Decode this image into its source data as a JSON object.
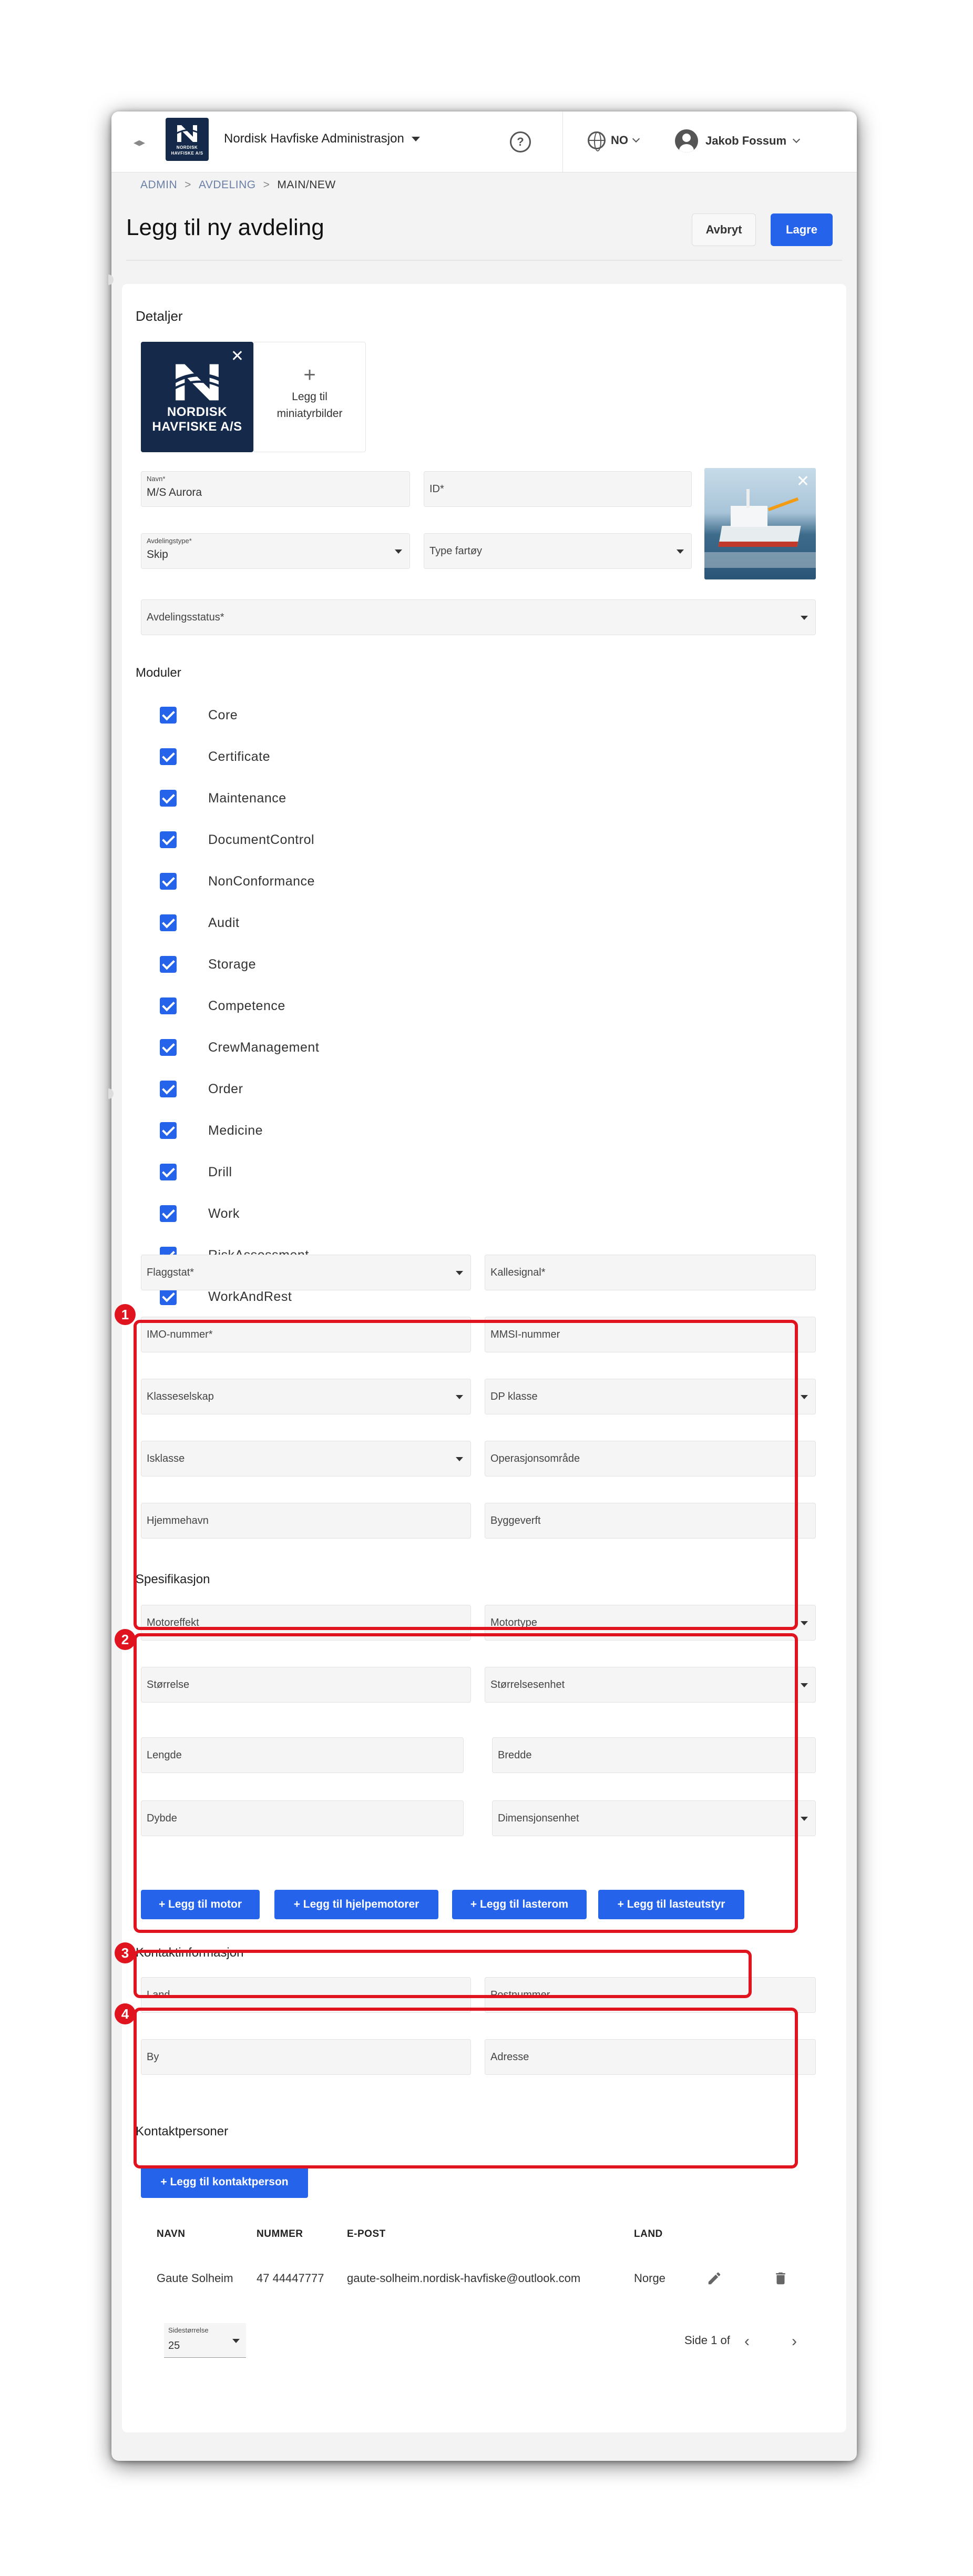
{
  "header": {
    "org_name": "Nordisk Havfiske Administrasjon",
    "logo_text_1": "NORDISK",
    "logo_text_2": "HAVFISKE A/S",
    "language": "NO",
    "user_name": "Jakob Fossum"
  },
  "breadcrumb": [
    "ADMIN",
    "AVDELING",
    "MAIN/NEW"
  ],
  "page": {
    "title": "Legg til ny avdeling",
    "cancel_label": "Avbryt",
    "save_label": "Lagre"
  },
  "details": {
    "section_label": "Detaljer",
    "logo_thumb_line1": "NORDISK",
    "logo_thumb_line2": "HAVFISKE A/S",
    "add_thumb_label_1": "Legg til",
    "add_thumb_label_2": "miniatyrbilder",
    "name_label": "Navn*",
    "name_value": "M/S Aurora",
    "id_placeholder": "ID*",
    "type_label": "Avdelingstype*",
    "type_value": "Skip",
    "vessel_type_placeholder": "Type fartøy",
    "status_placeholder": "Avdelingsstatus*"
  },
  "modules": {
    "label": "Moduler",
    "items": [
      "Core",
      "Certificate",
      "Maintenance",
      "DocumentControl",
      "NonConformance",
      "Audit",
      "Storage",
      "Competence",
      "CrewManagement",
      "Order",
      "Medicine",
      "Drill",
      "Work",
      "RiskAssessment",
      "WorkAndRest"
    ]
  },
  "vessel_info": {
    "badge": "1",
    "flag_state": "Flaggstat*",
    "call_sign": "Kallesignal*",
    "imo": "IMO-nummer*",
    "mmsi": "MMSI-nummer",
    "class_society": "Klasseselskap",
    "dp_class": "DP klasse",
    "ice_class": "Isklasse",
    "operation_area": "Operasjonsområde",
    "home_port": "Hjemmehavn",
    "shipyard": "Byggeverft"
  },
  "specification": {
    "badge": "2",
    "label": "Spesifikasjon",
    "engine_power": "Motoreffekt",
    "engine_type": "Motortype",
    "size": "Størrelse",
    "size_unit": "Størrelsesenhet",
    "length": "Lengde",
    "width": "Bredde",
    "depth": "Dybde",
    "dimension_unit": "Dimensjonsenhet"
  },
  "add_buttons": {
    "badge": "3",
    "engine": "+ Legg til motor",
    "aux_engines": "+ Legg til hjelpemotorer",
    "cargo_hold": "+ Legg til lasterom",
    "cargo_equipment": "+ Legg til lasteutstyr"
  },
  "contact_info": {
    "badge": "4",
    "label": "Kontaktinformasjon",
    "country": "Land",
    "postal_code": "Postnummer",
    "city": "By",
    "address": "Adresse"
  },
  "contacts": {
    "label": "Kontaktpersoner",
    "add_label": "+ Legg til kontaktperson",
    "columns": [
      "NAVN",
      "NUMMER",
      "E-POST",
      "LAND"
    ],
    "rows": [
      {
        "name": "Gaute Solheim",
        "number": "47 44447777",
        "email": "gaute-solheim.nordisk-havfiske@outlook.com",
        "country": "Norge"
      }
    ],
    "page_size_label": "Sidestørrelse",
    "page_size_value": "25",
    "page_info": "Side 1 of"
  },
  "colors": {
    "accent": "#2563eb",
    "highlight": "#e0141e",
    "logo_bg": "#152a4a"
  }
}
